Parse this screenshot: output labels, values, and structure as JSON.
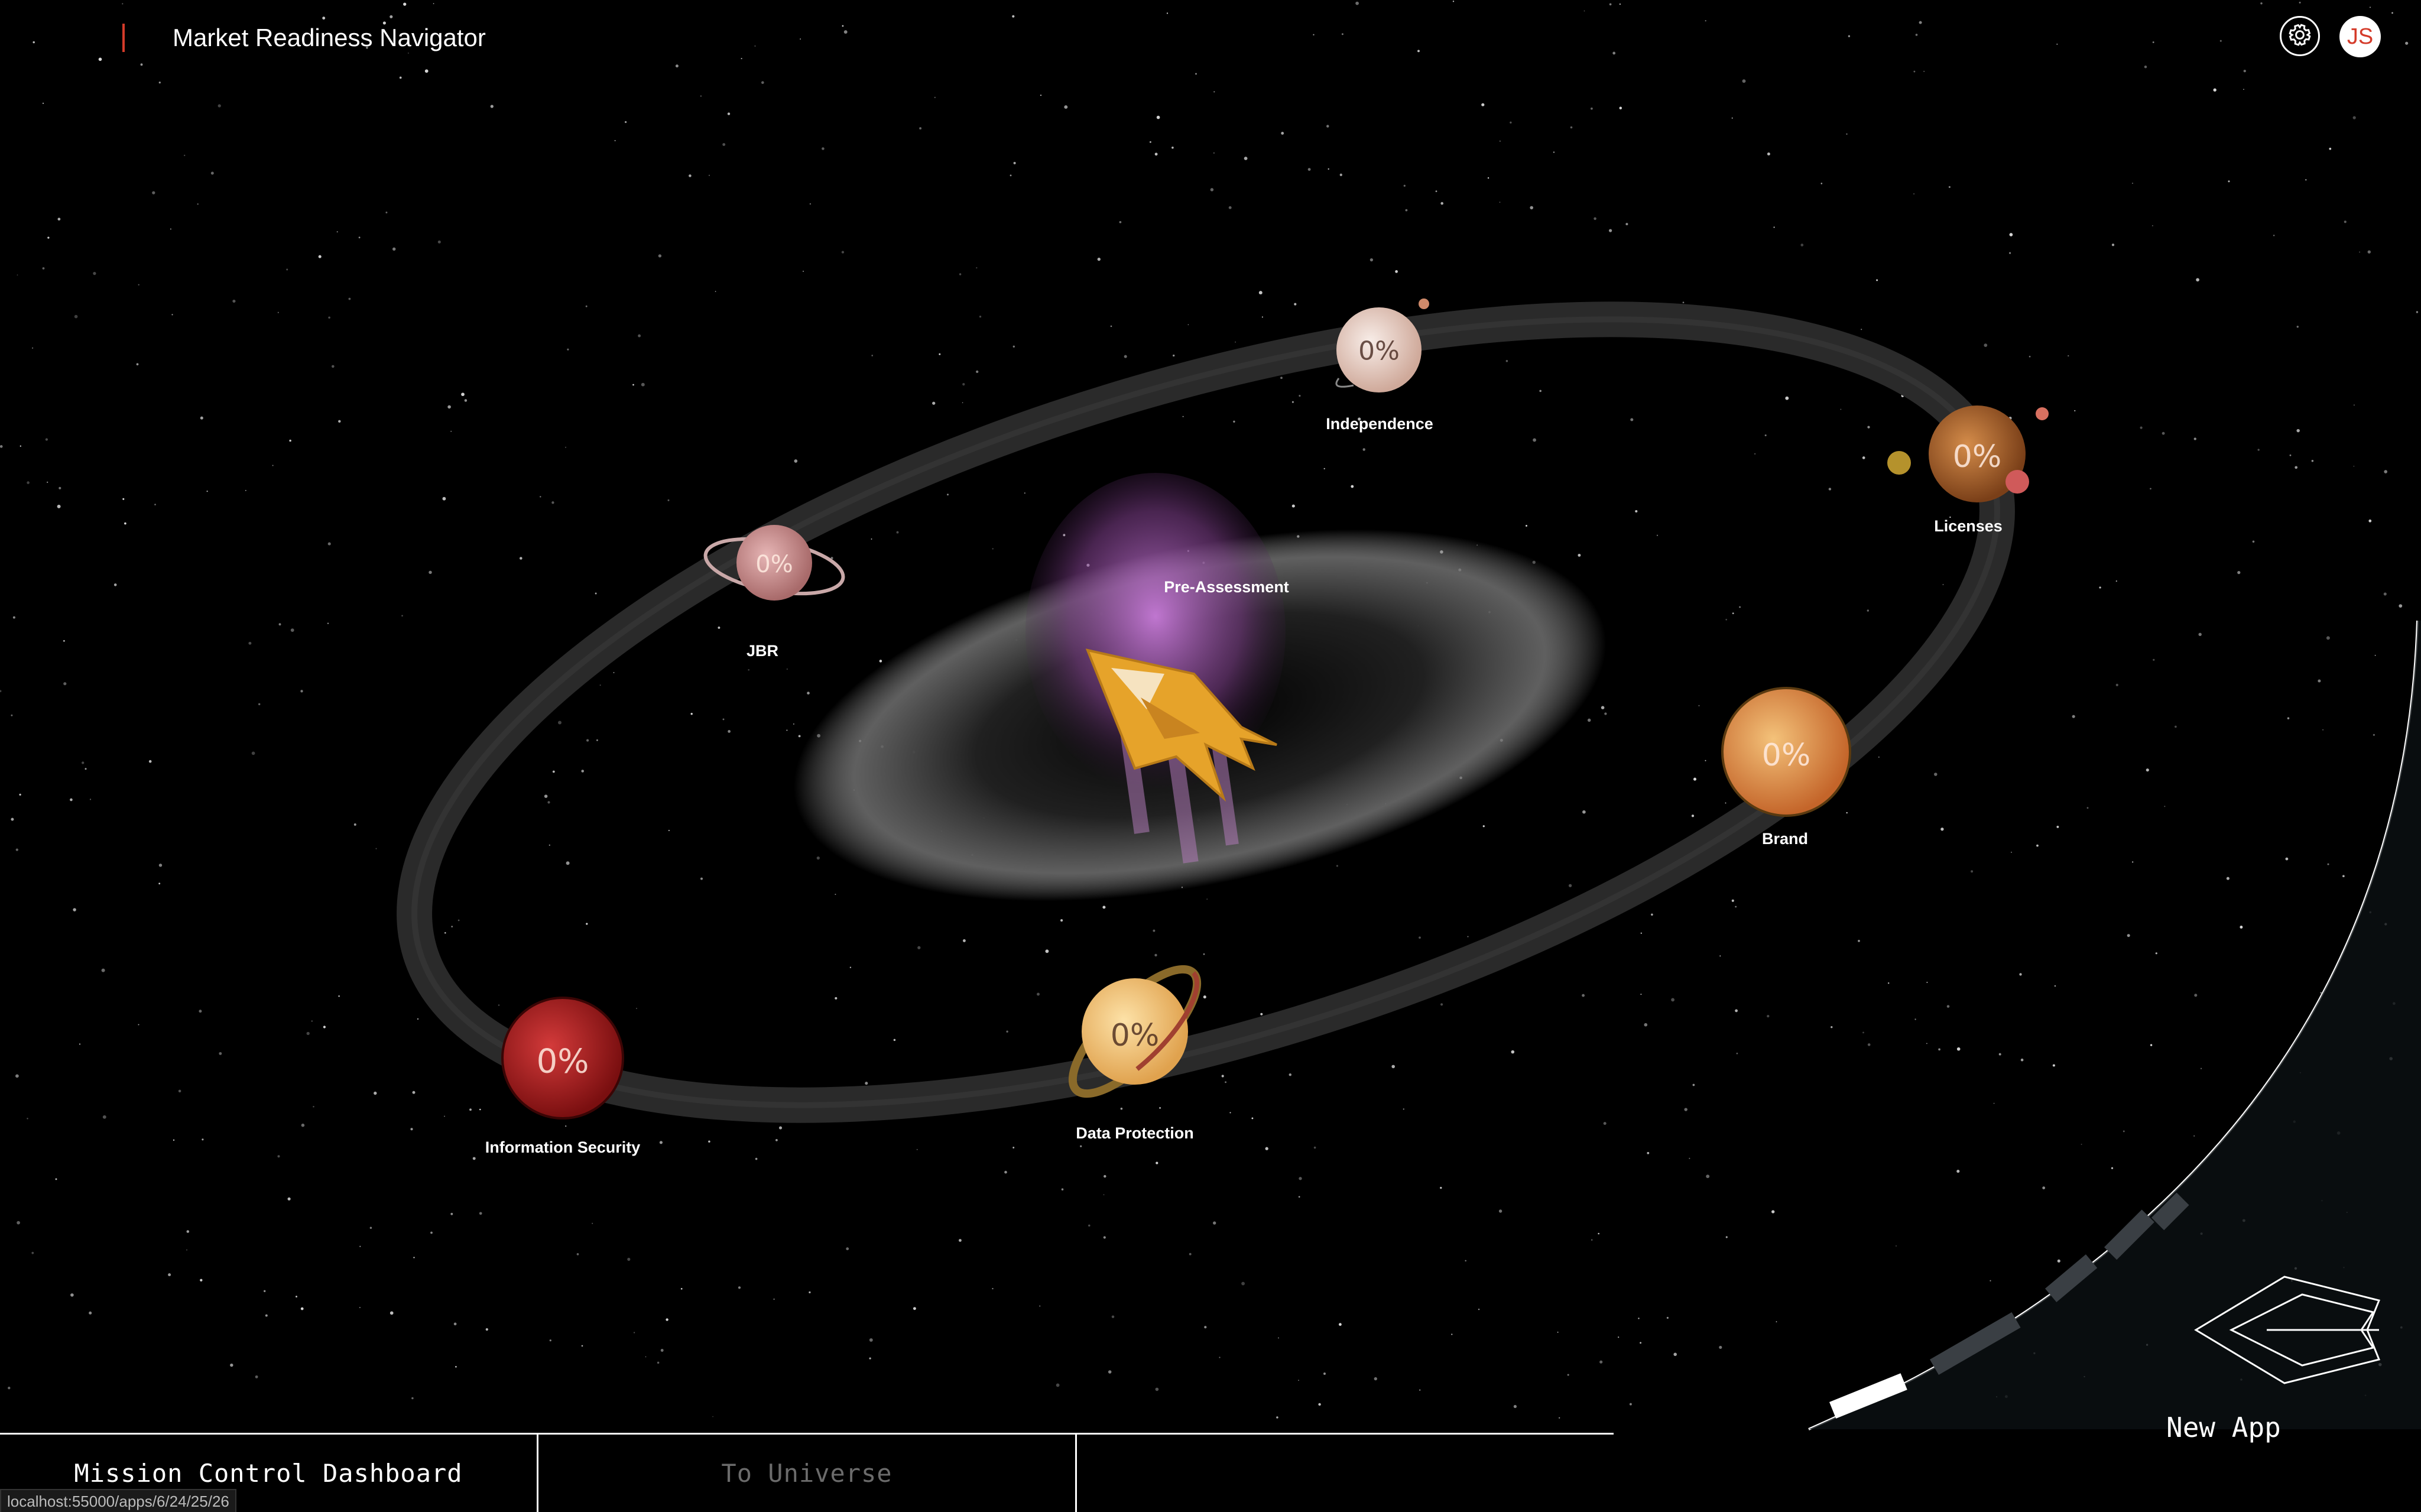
{
  "app": {
    "title": "Market Readiness Navigator",
    "user_initials": "JS",
    "accent_color": "#d43b2a"
  },
  "header": {
    "settings_icon": "gear-icon"
  },
  "center": {
    "label": "Pre-Assessment",
    "icon": "ship-logo-icon"
  },
  "planets": [
    {
      "name": "Independence",
      "progress": "0%",
      "color": "#ead7cf"
    },
    {
      "name": "Licenses",
      "progress": "0%",
      "color": "#b46a2e"
    },
    {
      "name": "JBR",
      "progress": "0%",
      "color": "#c98c8c"
    },
    {
      "name": "Brand",
      "progress": "0%",
      "color": "#e9a34a"
    },
    {
      "name": "Data Protection",
      "progress": "0%",
      "color": "#f3c878"
    },
    {
      "name": "Information Security",
      "progress": "0%",
      "color": "#b71f1f"
    }
  ],
  "bottom": {
    "dashboard_label": "Mission Control Dashboard",
    "universe_label": "To Universe",
    "new_app_label": "New App"
  },
  "status_url": "localhost:55000/apps/6/24/25/26"
}
